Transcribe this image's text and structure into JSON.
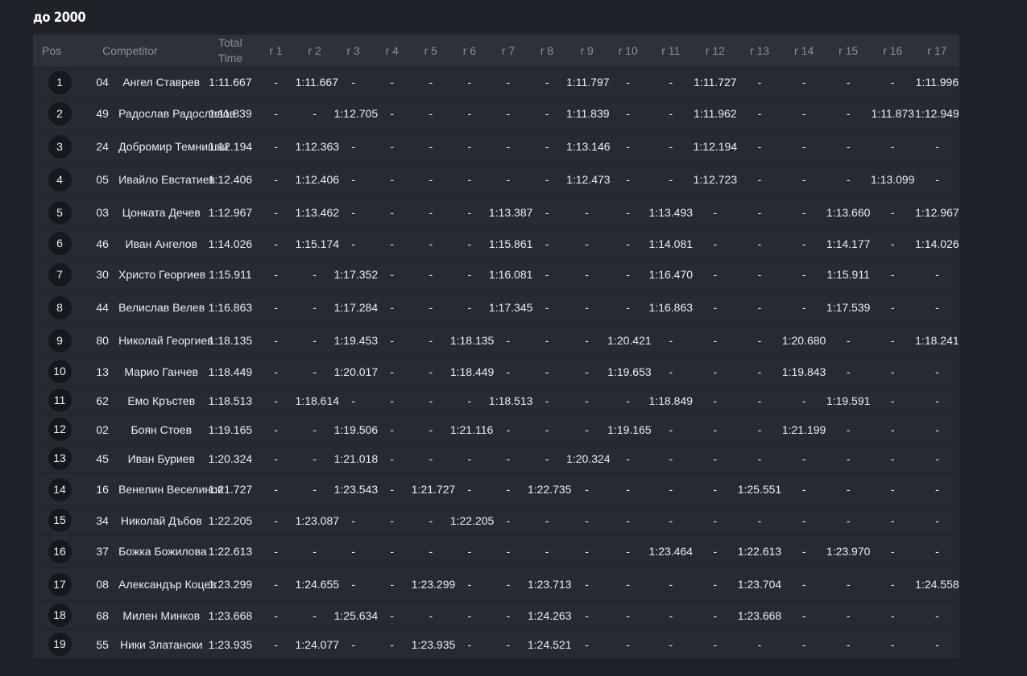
{
  "title": "до 2000",
  "headers": {
    "pos": "Pos",
    "competitor": "Competitor",
    "total_line1": "Total",
    "total_line2": "Time",
    "rounds": [
      "r 1",
      "r 2",
      "r 3",
      "r 4",
      "r 5",
      "r 6",
      "r 7",
      "r 8",
      "r 9",
      "r 10",
      "r 11",
      "r 12",
      "r 13",
      "r 14",
      "r 15",
      "r 16",
      "r 17"
    ]
  },
  "rows": [
    {
      "pos": "1",
      "num": "04",
      "name": "Ангел Ставрев",
      "total": "1:11.667",
      "laps": [
        "-",
        "1:11.667",
        "-",
        "-",
        "-",
        "-",
        "-",
        "-",
        "1:11.797",
        "-",
        "-",
        "1:11.727",
        "-",
        "-",
        "-",
        "-",
        "1:11.996"
      ]
    },
    {
      "pos": "2",
      "num": "49",
      "name": "Радослав Радославов",
      "total": "1:11.839",
      "laps": [
        "-",
        "-",
        "1:12.705",
        "-",
        "-",
        "-",
        "-",
        "-",
        "1:11.839",
        "-",
        "-",
        "1:11.962",
        "-",
        "-",
        "-",
        "1:11.873",
        "1:12.949"
      ]
    },
    {
      "pos": "3",
      "num": "24",
      "name": "Добромир Темнишки",
      "total": "1:12.194",
      "laps": [
        "-",
        "1:12.363",
        "-",
        "-",
        "-",
        "-",
        "-",
        "-",
        "1:13.146",
        "-",
        "-",
        "1:12.194",
        "-",
        "-",
        "-",
        "-",
        "-"
      ]
    },
    {
      "pos": "4",
      "num": "05",
      "name": "Ивайло Евстатиев",
      "total": "1:12.406",
      "laps": [
        "-",
        "1:12.406",
        "-",
        "-",
        "-",
        "-",
        "-",
        "-",
        "1:12.473",
        "-",
        "-",
        "1:12.723",
        "-",
        "-",
        "-",
        "1:13.099",
        "-"
      ]
    },
    {
      "pos": "5",
      "num": "03",
      "name": "Цонката Дечев",
      "total": "1:12.967",
      "laps": [
        "-",
        "1:13.462",
        "-",
        "-",
        "-",
        "-",
        "1:13.387",
        "-",
        "-",
        "-",
        "1:13.493",
        "-",
        "-",
        "-",
        "1:13.660",
        "-",
        "1:12.967"
      ]
    },
    {
      "pos": "6",
      "num": "46",
      "name": "Иван Ангелов",
      "total": "1:14.026",
      "laps": [
        "-",
        "1:15.174",
        "-",
        "-",
        "-",
        "-",
        "1:15.861",
        "-",
        "-",
        "-",
        "1:14.081",
        "-",
        "-",
        "-",
        "1:14.177",
        "-",
        "1:14.026"
      ]
    },
    {
      "pos": "7",
      "num": "30",
      "name": "Христо Георгиев",
      "total": "1:15.911",
      "laps": [
        "-",
        "-",
        "1:17.352",
        "-",
        "-",
        "-",
        "1:16.081",
        "-",
        "-",
        "-",
        "1:16.470",
        "-",
        "-",
        "-",
        "1:15.911",
        "-",
        "-"
      ]
    },
    {
      "pos": "8",
      "num": "44",
      "name": "Велислав Велев",
      "total": "1:16.863",
      "laps": [
        "-",
        "-",
        "1:17.284",
        "-",
        "-",
        "-",
        "1:17.345",
        "-",
        "-",
        "-",
        "1:16.863",
        "-",
        "-",
        "-",
        "1:17.539",
        "-",
        "-"
      ]
    },
    {
      "pos": "9",
      "num": "80",
      "name": "Николай Георгиев",
      "total": "1:18.135",
      "laps": [
        "-",
        "-",
        "1:19.453",
        "-",
        "-",
        "1:18.135",
        "-",
        "-",
        "-",
        "1:20.421",
        "-",
        "-",
        "-",
        "1:20.680",
        "-",
        "-",
        "1:18.241"
      ]
    },
    {
      "pos": "10",
      "num": "13",
      "name": "Марио Ганчев",
      "total": "1:18.449",
      "laps": [
        "-",
        "-",
        "1:20.017",
        "-",
        "-",
        "1:18.449",
        "-",
        "-",
        "-",
        "1:19.653",
        "-",
        "-",
        "-",
        "1:19.843",
        "-",
        "-",
        "-"
      ]
    },
    {
      "pos": "11",
      "num": "62",
      "name": "Емо Кръстев",
      "total": "1:18.513",
      "laps": [
        "-",
        "1:18.614",
        "-",
        "-",
        "-",
        "-",
        "1:18.513",
        "-",
        "-",
        "-",
        "1:18.849",
        "-",
        "-",
        "-",
        "1:19.591",
        "-",
        "-"
      ]
    },
    {
      "pos": "12",
      "num": "02",
      "name": "Боян Стоев",
      "total": "1:19.165",
      "laps": [
        "-",
        "-",
        "1:19.506",
        "-",
        "-",
        "1:21.116",
        "-",
        "-",
        "-",
        "1:19.165",
        "-",
        "-",
        "-",
        "1:21.199",
        "-",
        "-",
        "-"
      ]
    },
    {
      "pos": "13",
      "num": "45",
      "name": "Иван Буриев",
      "total": "1:20.324",
      "laps": [
        "-",
        "-",
        "1:21.018",
        "-",
        "-",
        "-",
        "-",
        "-",
        "1:20.324",
        "-",
        "-",
        "-",
        "-",
        "-",
        "-",
        "-",
        "-"
      ]
    },
    {
      "pos": "14",
      "num": "16",
      "name": "Венелин Веселинов",
      "total": "1:21.727",
      "laps": [
        "-",
        "-",
        "1:23.543",
        "-",
        "1:21.727",
        "-",
        "-",
        "1:22.735",
        "-",
        "-",
        "-",
        "-",
        "1:25.551",
        "-",
        "-",
        "-",
        "-"
      ]
    },
    {
      "pos": "15",
      "num": "34",
      "name": "Николай Дъбов",
      "total": "1:22.205",
      "laps": [
        "-",
        "1:23.087",
        "-",
        "-",
        "-",
        "1:22.205",
        "-",
        "-",
        "-",
        "-",
        "-",
        "-",
        "-",
        "-",
        "-",
        "-",
        "-"
      ]
    },
    {
      "pos": "16",
      "num": "37",
      "name": "Божка Божилова",
      "total": "1:22.613",
      "laps": [
        "-",
        "-",
        "-",
        "-",
        "-",
        "-",
        "-",
        "-",
        "-",
        "-",
        "1:23.464",
        "-",
        "1:22.613",
        "-",
        "1:23.970",
        "-",
        "-"
      ]
    },
    {
      "pos": "17",
      "num": "08",
      "name": "Александър Коцев",
      "total": "1:23.299",
      "laps": [
        "-",
        "1:24.655",
        "-",
        "-",
        "1:23.299",
        "-",
        "-",
        "1:23.713",
        "-",
        "-",
        "-",
        "-",
        "1:23.704",
        "-",
        "-",
        "-",
        "1:24.558"
      ]
    },
    {
      "pos": "18",
      "num": "68",
      "name": "Милен Минков",
      "total": "1:23.668",
      "laps": [
        "-",
        "-",
        "1:25.634",
        "-",
        "-",
        "-",
        "-",
        "1:24.263",
        "-",
        "-",
        "-",
        "-",
        "1:23.668",
        "-",
        "-",
        "-",
        "-"
      ]
    },
    {
      "pos": "19",
      "num": "55",
      "name": "Ники Златански",
      "total": "1:23.935",
      "laps": [
        "-",
        "1:24.077",
        "-",
        "-",
        "1:23.935",
        "-",
        "-",
        "1:24.521",
        "-",
        "-",
        "-",
        "-",
        "-",
        "-",
        "-",
        "-",
        "-"
      ]
    }
  ]
}
